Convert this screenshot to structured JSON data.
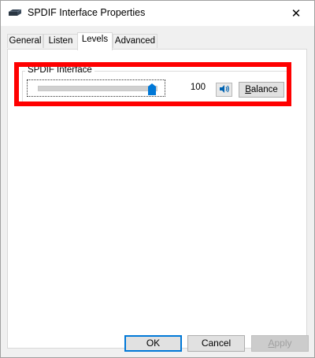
{
  "window": {
    "title": "SPDIF Interface Properties",
    "close_glyph": "✕"
  },
  "tabs": [
    {
      "label": "General",
      "active": false
    },
    {
      "label": "Listen",
      "active": false
    },
    {
      "label": "Levels",
      "active": true
    },
    {
      "label": "Advanced",
      "active": false
    }
  ],
  "levels": {
    "group_title": "SPDIF Interface",
    "value": "100",
    "slider_level_fraction": 1.0,
    "balance_label_first": "B",
    "balance_label_rest": "alance",
    "speaker_icon": "speaker-icon"
  },
  "buttons": {
    "ok": "OK",
    "cancel": "Cancel",
    "apply_first": "A",
    "apply_rest": "pply"
  },
  "colors": {
    "accent": "#0078d7",
    "highlight": "#ff0000"
  }
}
